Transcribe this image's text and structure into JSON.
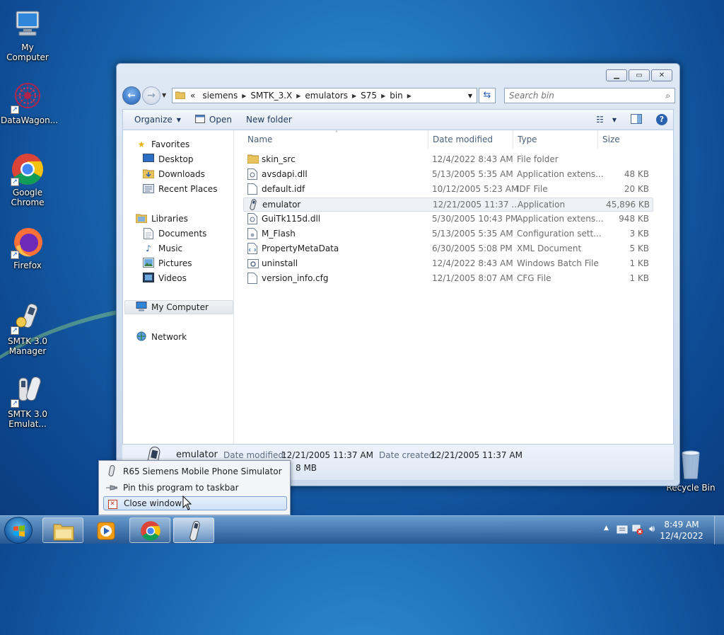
{
  "desktop": {
    "icons": [
      {
        "label": "My Computer",
        "icon": "computer-icon"
      },
      {
        "label": "DataWagon...",
        "icon": "datawagon-icon"
      },
      {
        "label": "Google Chrome",
        "icon": "chrome-icon"
      },
      {
        "label": "Firefox",
        "icon": "firefox-icon"
      },
      {
        "label": "SMTK 3.0 Manager",
        "icon": "phone-icon"
      },
      {
        "label": "SMTK 3.0 Emulat...",
        "icon": "phone-icon"
      },
      {
        "label": "Recycle Bin",
        "icon": "recycle-bin-icon"
      }
    ]
  },
  "explorer": {
    "breadcrumb": {
      "overflow": "«",
      "items": [
        "siemens",
        "SMTK_3.X",
        "emulators",
        "S75",
        "bin"
      ]
    },
    "search": {
      "placeholder": "Search bin"
    },
    "toolbar": {
      "organize": "Organize",
      "open": "Open",
      "new_folder": "New folder"
    },
    "nav": {
      "favorites": "Favorites",
      "desktop": "Desktop",
      "downloads": "Downloads",
      "recent_places": "Recent Places",
      "libraries": "Libraries",
      "documents": "Documents",
      "music": "Music",
      "pictures": "Pictures",
      "videos": "Videos",
      "my_computer": "My Computer",
      "network": "Network"
    },
    "columns": {
      "name": "Name",
      "date": "Date modified",
      "type": "Type",
      "size": "Size"
    },
    "files": [
      {
        "name": "skin_src",
        "date": "12/4/2022 8:43 AM",
        "type": "File folder",
        "size": "",
        "icon": "folder-icon"
      },
      {
        "name": "avsdapi.dll",
        "date": "5/13/2005 5:35 AM",
        "type": "Application extens...",
        "size": "48 KB",
        "icon": "dll-icon"
      },
      {
        "name": "default.idf",
        "date": "10/12/2005 5:23 AM",
        "type": "IDF File",
        "size": "20 KB",
        "icon": "file-icon"
      },
      {
        "name": "emulator",
        "date": "12/21/2005 11:37 ...",
        "type": "Application",
        "size": "45,896 KB",
        "icon": "phone-icon"
      },
      {
        "name": "GuiTk115d.dll",
        "date": "5/30/2005 10:43 PM",
        "type": "Application extens...",
        "size": "948 KB",
        "icon": "dll-icon"
      },
      {
        "name": "M_Flash",
        "date": "5/13/2005 5:35 AM",
        "type": "Configuration sett...",
        "size": "3 KB",
        "icon": "config-icon"
      },
      {
        "name": "PropertyMetaData",
        "date": "6/30/2005 5:08 PM",
        "type": "XML Document",
        "size": "5 KB",
        "icon": "xml-icon"
      },
      {
        "name": "uninstall",
        "date": "12/4/2022 8:43 AM",
        "type": "Windows Batch File",
        "size": "1 KB",
        "icon": "batch-icon"
      },
      {
        "name": "version_info.cfg",
        "date": "12/1/2005 8:07 AM",
        "type": "CFG File",
        "size": "1 KB",
        "icon": "file-icon"
      }
    ],
    "details": {
      "name": "emulator",
      "modified_label": "Date modified:",
      "modified_value": "12/21/2005 11:37 AM",
      "created_label": "Date created:",
      "created_value": "12/21/2005 11:37 AM",
      "size_partial": "8 MB"
    }
  },
  "jumplist": {
    "items": [
      {
        "label": "R65 Siemens Mobile Phone Simulator",
        "icon": "phone-icon"
      },
      {
        "label": "Pin this program to taskbar",
        "icon": "pin-icon"
      },
      {
        "label": "Close window",
        "icon": "close-icon"
      }
    ]
  },
  "taskbar": {
    "apps": [
      "explorer-icon",
      "media-player-icon",
      "chrome-icon",
      "phone-icon"
    ],
    "clock": {
      "time": "8:49 AM",
      "date": "12/4/2022"
    }
  }
}
